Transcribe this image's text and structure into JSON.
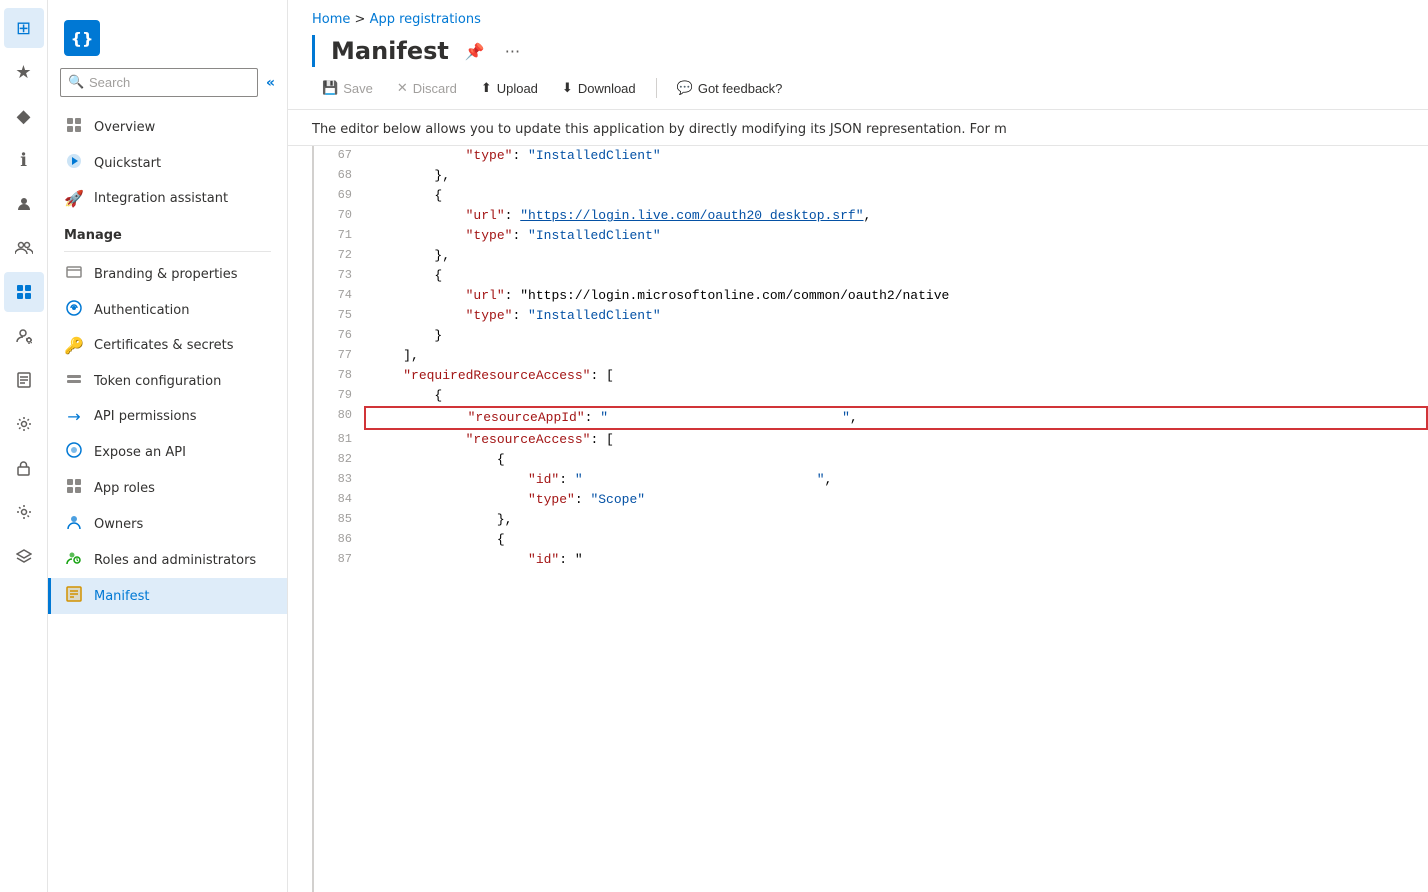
{
  "iconBar": {
    "items": [
      {
        "name": "home-icon",
        "icon": "⊞",
        "active": true
      },
      {
        "name": "star-icon",
        "icon": "★",
        "active": false
      },
      {
        "name": "diamond-icon",
        "icon": "◆",
        "active": false
      },
      {
        "name": "info-icon",
        "icon": "ℹ",
        "active": false
      },
      {
        "name": "user-icon",
        "icon": "👤",
        "active": false
      },
      {
        "name": "users-icon",
        "icon": "👥",
        "active": false
      },
      {
        "name": "grid-icon",
        "icon": "⊞",
        "active": true
      },
      {
        "name": "person-gear-icon",
        "icon": "⚙",
        "active": false
      },
      {
        "name": "document-icon",
        "icon": "📄",
        "active": false
      },
      {
        "name": "settings-icon",
        "icon": "⚙",
        "active": false
      },
      {
        "name": "lock-icon",
        "icon": "🔒",
        "active": false
      },
      {
        "name": "gear2-icon",
        "icon": "⚙",
        "active": false
      },
      {
        "name": "layers-icon",
        "icon": "⧉",
        "active": false
      }
    ]
  },
  "breadcrumb": {
    "home_label": "Home",
    "separator": ">",
    "current": "App registrations"
  },
  "appIcon": {
    "symbol": "{}"
  },
  "search": {
    "placeholder": "Search"
  },
  "collapseBtn": "«",
  "nav": {
    "overview": "Overview",
    "quickstart": "Quickstart",
    "integration": "Integration assistant"
  },
  "manage": {
    "label": "Manage",
    "items": [
      {
        "key": "branding",
        "label": "Branding & properties"
      },
      {
        "key": "authentication",
        "label": "Authentication"
      },
      {
        "key": "certificates",
        "label": "Certificates & secrets"
      },
      {
        "key": "token",
        "label": "Token configuration"
      },
      {
        "key": "api",
        "label": "API permissions"
      },
      {
        "key": "expose",
        "label": "Expose an API"
      },
      {
        "key": "approles",
        "label": "App roles"
      },
      {
        "key": "owners",
        "label": "Owners"
      },
      {
        "key": "roles",
        "label": "Roles and administrators"
      },
      {
        "key": "manifest",
        "label": "Manifest"
      }
    ]
  },
  "pageTitle": "Manifest",
  "toolbar": {
    "save": "Save",
    "discard": "Discard",
    "upload": "Upload",
    "download": "Download",
    "feedback": "Got feedback?"
  },
  "description": "The editor below allows you to update this application by directly modifying its JSON representation. For m",
  "code": {
    "lines": [
      {
        "num": 67,
        "content": "            \"type\": \"InstalledClient\"",
        "highlight": false
      },
      {
        "num": 68,
        "content": "        },",
        "highlight": false
      },
      {
        "num": 69,
        "content": "        {",
        "highlight": false
      },
      {
        "num": 70,
        "content": "            \"url\": \"https://login.live.com/oauth20_desktop.srf\",",
        "highlight": false
      },
      {
        "num": 71,
        "content": "            \"type\": \"InstalledClient\"",
        "highlight": false
      },
      {
        "num": 72,
        "content": "        },",
        "highlight": false
      },
      {
        "num": 73,
        "content": "        {",
        "highlight": false
      },
      {
        "num": 74,
        "content": "            \"url\": \"https://login.microsoftonline.com/common/oauth2/native",
        "highlight": false
      },
      {
        "num": 75,
        "content": "            \"type\": \"InstalledClient\"",
        "highlight": false
      },
      {
        "num": 76,
        "content": "        }",
        "highlight": false
      },
      {
        "num": 77,
        "content": "    ],",
        "highlight": false
      },
      {
        "num": 78,
        "content": "    \"requiredResourceAccess\": [",
        "highlight": false
      },
      {
        "num": 79,
        "content": "        {",
        "highlight": false
      },
      {
        "num": 80,
        "content": "            \"resourceAppId\": \"                              \",",
        "highlight": true
      },
      {
        "num": 81,
        "content": "            \"resourceAccess\": [",
        "highlight": false
      },
      {
        "num": 82,
        "content": "                {",
        "highlight": false
      },
      {
        "num": 83,
        "content": "                    \"id\": \"                              \",",
        "highlight": false
      },
      {
        "num": 84,
        "content": "                    \"type\": \"Scope\"",
        "highlight": false
      },
      {
        "num": 85,
        "content": "                },",
        "highlight": false
      },
      {
        "num": 86,
        "content": "                {",
        "highlight": false
      },
      {
        "num": 87,
        "content": "                    \"id\": \"",
        "highlight": false
      }
    ]
  }
}
